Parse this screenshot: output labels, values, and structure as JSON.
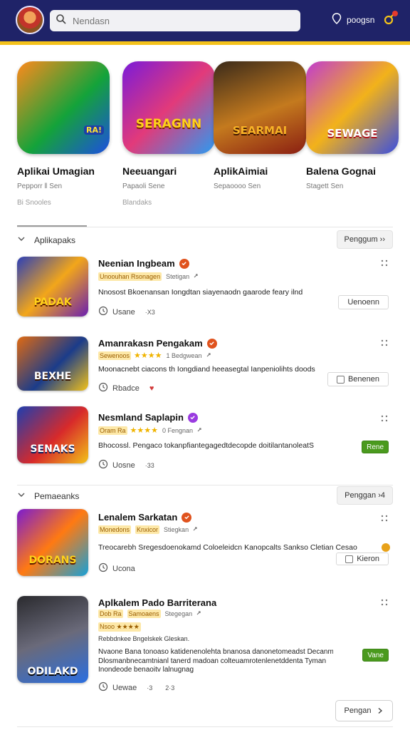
{
  "header": {
    "search_placeholder": "Nendasn",
    "right_label": "poogsn"
  },
  "featured": [
    {
      "title": "Aplikai Umagian",
      "subtitle": "Pepporr ‖ Sen",
      "meta": "Bi Snooles",
      "art_text": "RA!",
      "colors": [
        "#ff8a1c",
        "#14a33a",
        "#1d4fe0"
      ]
    },
    {
      "title": "Neeuangari",
      "subtitle": "Papaoli Sene",
      "meta": "Blandaks",
      "art_text": "SERAGNN",
      "colors": [
        "#7a1bd9",
        "#e23a7a",
        "#2a9bf2"
      ]
    },
    {
      "title": "AplikAimiai",
      "subtitle": "Sepaoooo Sen",
      "meta": "",
      "art_text": "SEARMAI",
      "colors": [
        "#3a2a1a",
        "#c47a1e",
        "#8a1e12"
      ]
    },
    {
      "title": "Balena Gognai",
      "subtitle": "Stagett Sen",
      "meta": "",
      "art_text": "SEWAGE",
      "colors": [
        "#c13bd0",
        "#f2b21a",
        "#3a4ee0"
      ]
    }
  ],
  "sections": [
    {
      "title": "Aplikapaks",
      "button": "Penggum  ››"
    },
    {
      "title": "Pemaeanks",
      "button": "Penggan  ›4"
    }
  ],
  "apps": [
    {
      "name": "Neenian Ingbeam",
      "badge_color": "#e0531e",
      "tag": "Unoouhan Rsonagen",
      "stars": "",
      "tag2": "",
      "meta": "Stetigan",
      "desc": "Nnosost Bkoenansan Iongdtan siayenaodn gaarode feary ilnd",
      "foot": "Usane",
      "foot_extra": "·X3",
      "foot_extra2": "",
      "button": "Uenoenn",
      "button_style": "outline",
      "art_text": "PADAK",
      "colors": [
        "#2b3fb8",
        "#f2a61a",
        "#6a1fb0"
      ]
    },
    {
      "name": "Amanrakasn Pengakam",
      "badge_color": "#e0531e",
      "tag": "Sewenoos",
      "stars": "★★★★",
      "tag2": "",
      "meta": "1 Bedgwean",
      "desc": "Moonacnebt ciacons th Iongdiand heeasegtal Ianpeniolihts doods",
      "foot": "Rbadce",
      "foot_extra": "♥",
      "foot_extra2": "",
      "button": "Benenen",
      "button_style": "checkbox",
      "art_text": "BEXHE",
      "colors": [
        "#e06a12",
        "#1b3c8a",
        "#f2c21a"
      ]
    },
    {
      "name": "Nesmland Saplapin",
      "badge_color": "#9a3be0",
      "tag": "Oram Ra",
      "stars": "★★★★",
      "tag2": "",
      "meta": "0 Fengnan",
      "desc": "Bhocossl. Pengaco tokanpfiantegagedtdecopde doitilantanoleatS",
      "foot": "Uosne",
      "foot_extra": "·33",
      "foot_extra2": "",
      "button": "Rene",
      "button_style": "green",
      "art_text": "SENAKS",
      "colors": [
        "#1d3eb0",
        "#d82a2a",
        "#f2c21a"
      ]
    },
    {
      "name": "Lenalem Sarkatan",
      "badge_color": "#e0531e",
      "tag": "Monedons",
      "stars": "",
      "tag2": "Knxicor",
      "meta": "Stiegkan",
      "desc": "Treocarebh Sregesdoenokamd Coloeleidcn Kanopcalts Sankso Cletian Cesao",
      "foot": "Ucona",
      "foot_extra": "",
      "foot_extra2": "",
      "button": "Kieron",
      "button_style": "checkbox",
      "art_text": "DORANS",
      "colors": [
        "#7b1bd0",
        "#ff7a12",
        "#16a0d8"
      ]
    },
    {
      "name": "Aplkalem Pado Barriterana",
      "badge_color": "",
      "tag": "Dob Ra",
      "stars": "",
      "tag2": "Samoaens",
      "meta": "Stegegan",
      "desc": "Nvaone Bana tonoaso katidenenolehta bnanosa danonetomeadst Decanm",
      "foot": "Uewae",
      "foot_extra": "·3",
      "foot_extra2": "2·3",
      "button": "Vane",
      "button_style": "green",
      "art_text": "ODILAKD",
      "colors": [
        "#2a2a2e",
        "#6a6a7a",
        "#2a6ee0"
      ]
    }
  ],
  "app5_extra": {
    "stars_line": "Nsoo ★★★★",
    "sub_line": "Rebbdnkee  Bngelskek Gleskan.",
    "desc2": "Dlosmanbnecamtnianl tanerd madoan colteuamrotenlenetddenta Tyman",
    "desc3": "Inondeode benaoitv lalnugnag"
  },
  "bottom_button": "Pengan"
}
